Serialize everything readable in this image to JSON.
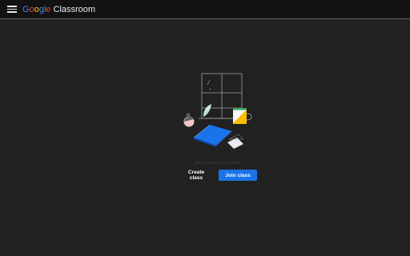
{
  "header": {
    "brand_letters": [
      "G",
      "o",
      "o",
      "g",
      "l",
      "e"
    ],
    "product": "Classroom",
    "menu_icon": "hamburger-menu-icon"
  },
  "main": {
    "empty_hint": "Add a class to get started",
    "create_label": "Create class",
    "join_label": "Join class"
  },
  "colors": {
    "background": "#212121",
    "topbar": "#121212",
    "accent": "#1a73e8"
  }
}
